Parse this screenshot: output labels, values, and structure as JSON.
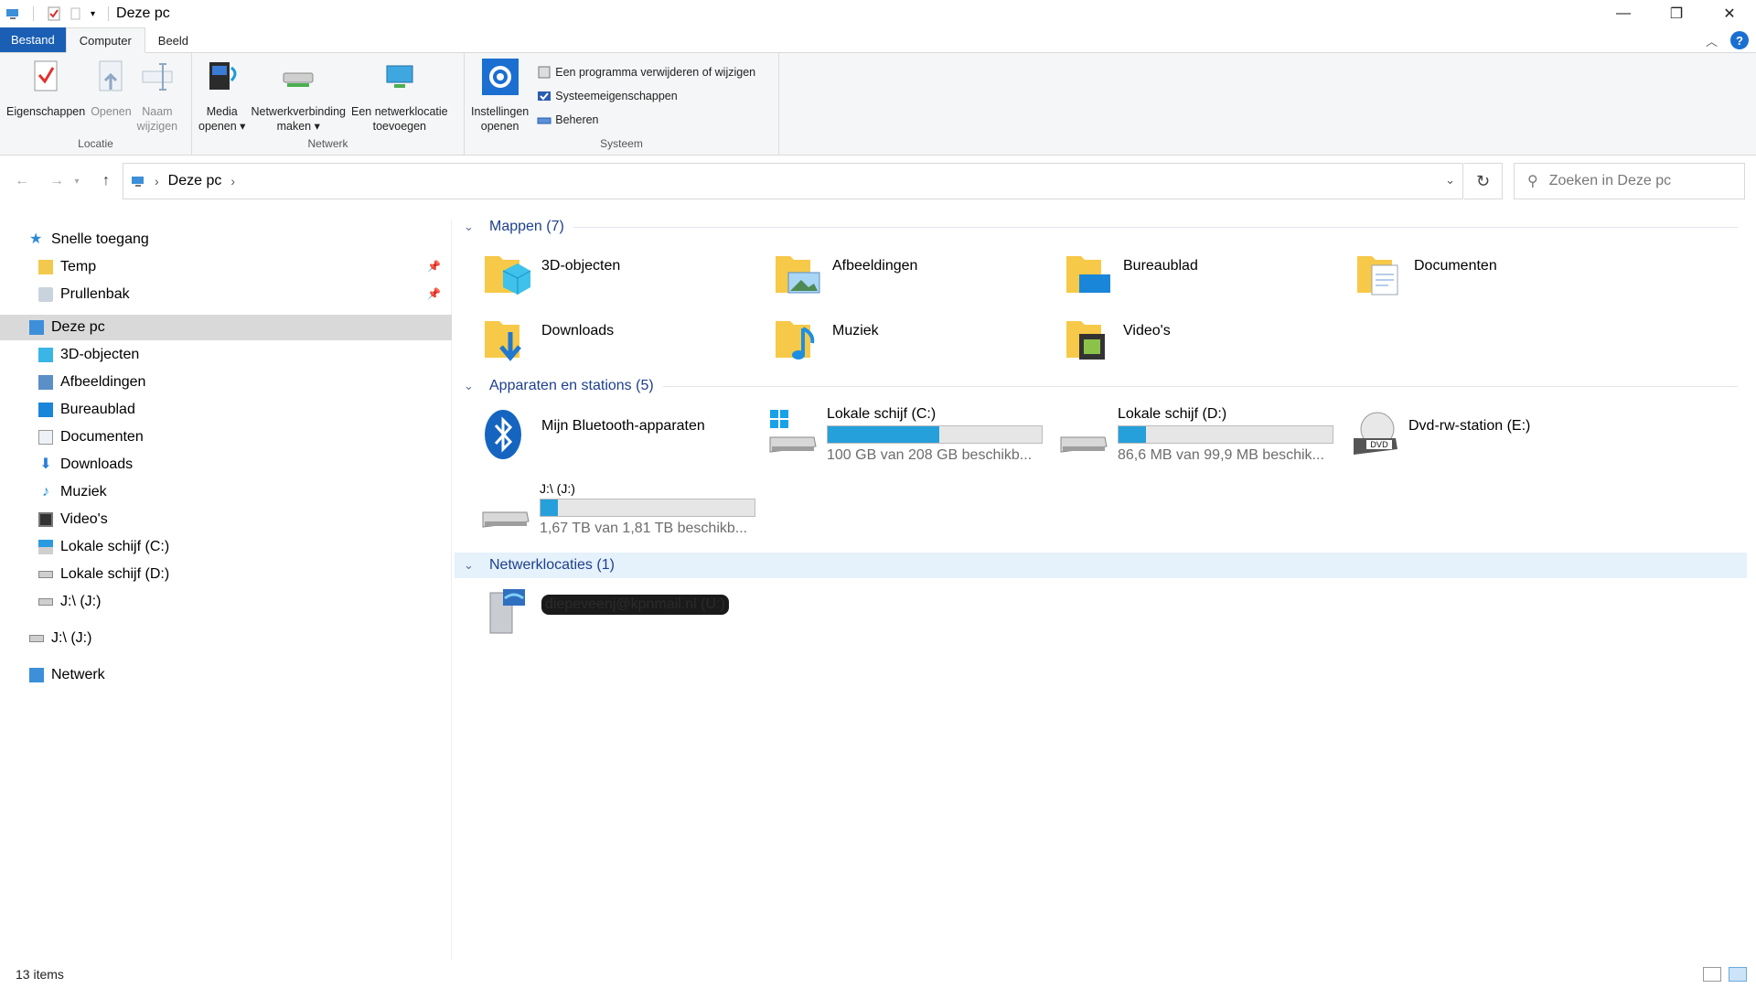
{
  "window": {
    "title": "Deze pc",
    "minimize": "—",
    "restore": "❐",
    "close": "✕"
  },
  "ribbon_tabs": [
    "Bestand",
    "Computer",
    "Beeld"
  ],
  "ribbon": {
    "locatie": {
      "label": "Locatie",
      "eigenschappen": "Eigenschappen",
      "openen": "Openen",
      "naam_1": "Naam",
      "naam_2": "wijzigen"
    },
    "netwerk": {
      "label": "Netwerk",
      "media_1": "Media",
      "media_2": "openen ▾",
      "verbinding_1": "Netwerkverbinding",
      "verbinding_2": "maken ▾",
      "locatie_1": "Een netwerklocatie",
      "locatie_2": "toevoegen"
    },
    "systeem": {
      "label": "Systeem",
      "instellingen_1": "Instellingen",
      "instellingen_2": "openen",
      "verwijderen": "Een programma verwijderen of wijzigen",
      "eigenschappen": "Systeemeigenschappen",
      "beheren": "Beheren"
    }
  },
  "address": {
    "crumb": "Deze pc",
    "search_placeholder": "Zoeken in Deze pc"
  },
  "nav": {
    "quick_access": "Snelle toegang",
    "temp": "Temp",
    "prullenbak": "Prullenbak",
    "deze_pc": "Deze pc",
    "items": [
      "3D-objecten",
      "Afbeeldingen",
      "Bureaublad",
      "Documenten",
      "Downloads",
      "Muziek",
      "Video's",
      "Lokale schijf (C:)",
      "Lokale schijf (D:)",
      "J:\\ (J:)"
    ],
    "j_drive": "J:\\ (J:)",
    "netwerk": "Netwerk"
  },
  "sections": {
    "mappen": "Mappen (7)",
    "apparaten": "Apparaten en stations (5)",
    "netwerk": "Netwerklocaties (1)"
  },
  "folders": [
    "3D-objecten",
    "Afbeeldingen",
    "Bureaublad",
    "Documenten",
    "Downloads",
    "Muziek",
    "Video's"
  ],
  "devices": {
    "bluetooth": "Mijn Bluetooth-apparaten",
    "c_name": "Lokale schijf (C:)",
    "c_sub": "100 GB van 208 GB beschikb...",
    "c_used": 0.52,
    "d_name": "Lokale schijf (D:)",
    "d_sub": "86,6 MB van 99,9 MB beschik...",
    "d_used": 0.13,
    "dvd": "Dvd-rw-station (E:)",
    "j_name": "J:\\ (J:)",
    "j_sub": "1,67 TB van 1,81 TB beschikb...",
    "j_used": 0.08
  },
  "network_location": "diepeveenj@kpnmail.nl (U:)",
  "status": {
    "items": "13 items"
  },
  "colors": {
    "accent": "#1a5fb4",
    "bar_fill": "#26a0da",
    "section_text": "#1e3f8e",
    "selection": "#d9d9d9"
  }
}
